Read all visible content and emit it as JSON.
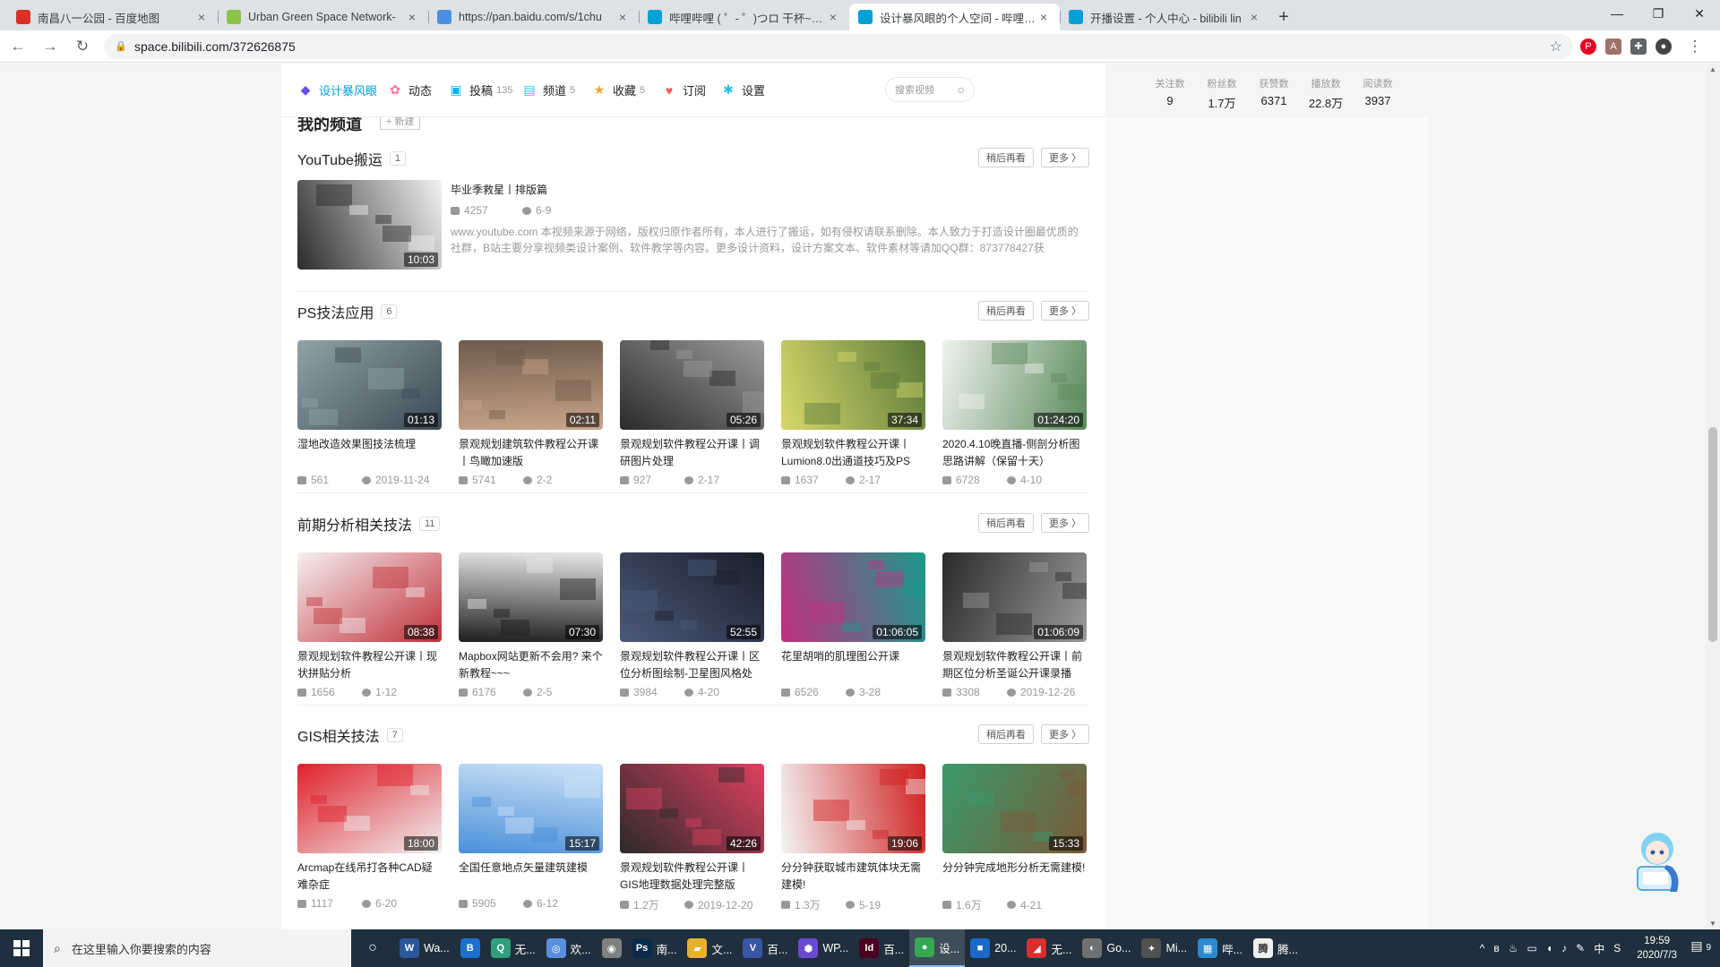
{
  "browser": {
    "tabs": [
      {
        "title": "南昌八一公园 - 百度地图",
        "color": "#d93025",
        "active": false
      },
      {
        "title": "Urban Green Space Network-",
        "color": "#8bc34a",
        "active": false
      },
      {
        "title": "https://pan.baidu.com/s/1chu",
        "color": "#4a90e2",
        "active": false
      },
      {
        "title": "哔哩哔哩 ( ゜- ゜)つロ 干杯~-bili",
        "color": "#00a1d6",
        "active": false
      },
      {
        "title": "设计暴风眼的个人空间 - 哔哩哔哩",
        "color": "#00a1d6",
        "active": true
      },
      {
        "title": "开播设置 - 个人中心 - bilibili lin",
        "color": "#00a1d6",
        "active": false
      }
    ],
    "url": "space.bilibili.com/372626875",
    "close_glyph": "×",
    "new_tab_glyph": "+",
    "window_controls": [
      "—",
      "❐",
      "✕"
    ],
    "nav_glyphs": {
      "back": "←",
      "forward": "→",
      "reload": "↻",
      "lock": "🔒",
      "star": "☆",
      "menu": "⋮"
    }
  },
  "space_nav": {
    "items": [
      {
        "label": "设计暴风眼",
        "count": "",
        "icon": "user-logo-icon",
        "glyph": "◆",
        "color": "#6b4cf5",
        "active": true
      },
      {
        "label": "动态",
        "count": "",
        "icon": "dynamic-icon",
        "glyph": "✿",
        "color": "#fb7299",
        "active": false
      },
      {
        "label": "投稿",
        "count": "135",
        "icon": "upload-icon",
        "glyph": "▣",
        "color": "#00b5e5",
        "active": false
      },
      {
        "label": "频道",
        "count": "5",
        "icon": "channel-icon",
        "glyph": "▤",
        "color": "#23c9ed",
        "active": false
      },
      {
        "label": "收藏",
        "count": "5",
        "icon": "favorite-icon",
        "glyph": "★",
        "color": "#f3a034",
        "active": false
      },
      {
        "label": "订阅",
        "count": "",
        "icon": "subscribe-icon",
        "glyph": "♥",
        "color": "#f25d5d",
        "active": false
      },
      {
        "label": "设置",
        "count": "",
        "icon": "settings-icon",
        "glyph": "✱",
        "color": "#20c5e0",
        "active": false
      }
    ],
    "search_placeholder": "搜索视频",
    "search_glyph": "○",
    "stats": [
      {
        "label": "关注数",
        "value": "9"
      },
      {
        "label": "粉丝数",
        "value": "1.7万"
      },
      {
        "label": "获赞数",
        "value": "6371"
      },
      {
        "label": "播放数",
        "value": "22.8万"
      },
      {
        "label": "阅读数",
        "value": "3937"
      }
    ]
  },
  "my_channels": {
    "title": "我的频道",
    "new_label": "+ 新建"
  },
  "labels": {
    "watch_later": "稍后再看",
    "more": "更多 〉"
  },
  "sections": [
    {
      "title": "YouTube搬运",
      "count": "1",
      "featured": {
        "title": "毕业季救星丨排版篇",
        "plays": "4257",
        "date": "6-9",
        "duration": "10:03",
        "description": "www.youtube.com 本视频来源于网络，版权归原作者所有，本人进行了搬运，如有侵权请联系删除。本人致力于打造设计圈最优质的社群，B站主要分享视频类设计案例、软件教学等内容。更多设计资料，设计方案文本、软件素材等请加QQ群：873778427获",
        "thumb": [
          "#f2f2f2",
          "#2b2b2b"
        ]
      }
    },
    {
      "title": "PS技法应用",
      "count": "6",
      "videos": [
        {
          "title": "湿地改造效果图技法梳理",
          "duration": "01:13",
          "plays": "561",
          "date": "2019-11-24",
          "thumb": [
            "#3b4a55",
            "#8fa3a8"
          ]
        },
        {
          "title": "景观规划建筑软件教程公开课丨鸟瞰加速版",
          "duration": "02:11",
          "plays": "5741",
          "date": "2-2",
          "thumb": [
            "#c9a58a",
            "#6e5a4c"
          ]
        },
        {
          "title": "景观规划软件教程公开课丨调研图片处理",
          "duration": "05:26",
          "plays": "927",
          "date": "2-17",
          "thumb": [
            "#2a2a2a",
            "#9c9c9c"
          ]
        },
        {
          "title": "景观规划软件教程公开课丨Lumion8.0出通道技巧及PS",
          "duration": "37:34",
          "plays": "1637",
          "date": "2-17",
          "thumb": [
            "#d8d86a",
            "#5a7a3a"
          ]
        },
        {
          "title": "2020.4.10晚直播-侧剖分析图思路讲解（保留十天）",
          "duration": "01:24:20",
          "plays": "6728",
          "date": "4-10",
          "thumb": [
            "#eef2ee",
            "#5a8a5a"
          ]
        }
      ]
    },
    {
      "title": "前期分析相关技法",
      "count": "11",
      "videos": [
        {
          "title": "景观规划软件教程公开课丨现状拼贴分析",
          "duration": "08:38",
          "plays": "1656",
          "date": "1-12",
          "thumb": [
            "#f5f0f0",
            "#c0303a"
          ]
        },
        {
          "title": "Mapbox网站更新不会用? 来个新教程~~~",
          "duration": "07:30",
          "plays": "6176",
          "date": "2-5",
          "thumb": [
            "#e8e8e8",
            "#1e1e1e"
          ]
        },
        {
          "title": "景观规划软件教程公开课丨区位分析图绘制-卫星图风格处",
          "duration": "52:55",
          "plays": "3984",
          "date": "4-20",
          "thumb": [
            "#1a1e2a",
            "#4a5a7a"
          ]
        },
        {
          "title": "花里胡哨的肌理图公开课",
          "duration": "01:06:05",
          "plays": "6526",
          "date": "3-28",
          "thumb": [
            "#1a9a8a",
            "#c03080"
          ]
        },
        {
          "title": "景观规划软件教程公开课丨前期区位分析圣诞公开课录播",
          "duration": "01:06:09",
          "plays": "3308",
          "date": "2019-12-26",
          "thumb": [
            "#9a9a9a",
            "#2a2a2a"
          ]
        }
      ]
    },
    {
      "title": "GIS相关技法",
      "count": "7",
      "videos": [
        {
          "title": "Arcmap在线吊打各种CAD疑难杂症",
          "duration": "18:00",
          "plays": "1117",
          "date": "6-20",
          "thumb": [
            "#f0f0f0",
            "#e0202a"
          ]
        },
        {
          "title": "全国任意地点矢量建筑建模",
          "duration": "15:17",
          "plays": "5905",
          "date": "6-12",
          "thumb": [
            "#4a90d9",
            "#cfe3f7"
          ]
        },
        {
          "title": "景观规划软件教程公开课丨GIS地理数据处理完整版",
          "duration": "42:26",
          "plays": "1.2万",
          "date": "2019-12-20",
          "thumb": [
            "#2a2a2a",
            "#e04060"
          ]
        },
        {
          "title": "分分钟获取城市建筑体块无需建模!",
          "duration": "19:06",
          "plays": "1.3万",
          "date": "5-19",
          "thumb": [
            "#f4f4f4",
            "#d02020"
          ]
        },
        {
          "title": "分分钟完成地形分析无需建模!",
          "duration": "15:33",
          "plays": "1.6万",
          "date": "4-21",
          "thumb": [
            "#3a9a6a",
            "#7a5a3a"
          ]
        }
      ]
    }
  ],
  "taskbar": {
    "search_placeholder": "在这里输入你要搜索的内容",
    "start_glyph": "⊞",
    "cortana_glyph": "○",
    "apps": [
      {
        "label": "Wa...",
        "icon": "word-icon",
        "glyph": "W",
        "color": "#2b579a",
        "active": false
      },
      {
        "label": "",
        "icon": "bluetooth-icon",
        "glyph": "B",
        "color": "#1c6fd1",
        "active": false
      },
      {
        "label": "无...",
        "icon": "search-tool-icon",
        "glyph": "Q",
        "color": "#2f9e7a",
        "active": false
      },
      {
        "label": "欢...",
        "icon": "chat-icon",
        "glyph": "◎",
        "color": "#5a8fe0",
        "active": false
      },
      {
        "label": "",
        "icon": "camera-icon",
        "glyph": "◉",
        "color": "#808080",
        "active": false
      },
      {
        "label": "南...",
        "icon": "photoshop-icon",
        "glyph": "Ps",
        "color": "#0a2a4a",
        "active": false
      },
      {
        "label": "文...",
        "icon": "folder-icon",
        "glyph": "▰",
        "color": "#e8b030",
        "active": false
      },
      {
        "label": "百...",
        "icon": "visio-icon",
        "glyph": "V",
        "color": "#3955a3",
        "active": false
      },
      {
        "label": "WP...",
        "icon": "wps-icon",
        "glyph": "⬢",
        "color": "#6a4ad0",
        "active": false
      },
      {
        "label": "百...",
        "icon": "indesign-icon",
        "glyph": "Id",
        "color": "#49021f",
        "active": false
      },
      {
        "label": "设...",
        "icon": "chrome-icon",
        "glyph": "●",
        "color": "#34a853",
        "active": true
      },
      {
        "label": "20...",
        "icon": "app-icon",
        "glyph": "■",
        "color": "#1b6ac9",
        "active": false
      },
      {
        "label": "无...",
        "icon": "red-app-icon",
        "glyph": "◢",
        "color": "#d43030",
        "active": false
      },
      {
        "label": "Go...",
        "icon": "globe-icon",
        "glyph": "◐",
        "color": "#707070",
        "active": false
      },
      {
        "label": "Mi...",
        "icon": "minecraft-icon",
        "glyph": "✦",
        "color": "#505050",
        "active": false
      },
      {
        "label": "哔...",
        "icon": "bilibili-icon",
        "glyph": "▦",
        "color": "#2a8ad0",
        "active": false
      },
      {
        "label": "腾...",
        "icon": "tencent-icon",
        "glyph": "腾",
        "color": "#f0f0f0",
        "active": false
      }
    ],
    "tray": {
      "glyphs": [
        "^",
        "ʙ",
        "♨",
        "▭",
        "◖",
        "♪",
        "✎",
        "中",
        "S"
      ],
      "time": "19:59",
      "date": "2020/7/3",
      "notif_glyph": "▤",
      "notif_count": "9"
    }
  }
}
